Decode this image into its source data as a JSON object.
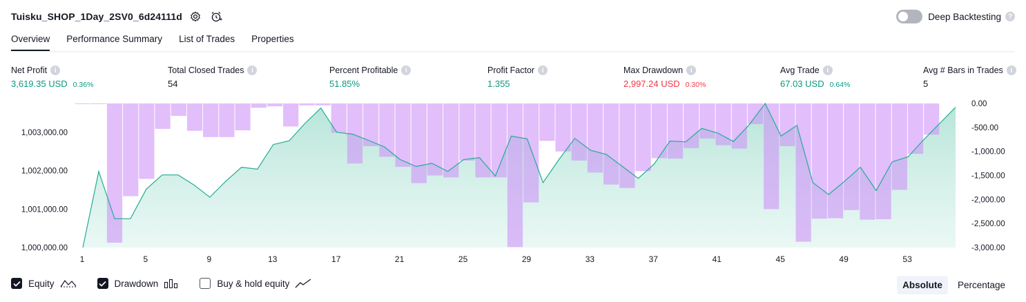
{
  "header": {
    "title": "Tuisku_SHOP_1Day_2SV0_6d24111d",
    "deep_backtesting_label": "Deep Backtesting"
  },
  "tabs": [
    "Overview",
    "Performance Summary",
    "List of Trades",
    "Properties"
  ],
  "stats": [
    {
      "label": "Net Profit",
      "value": "3,619.35 USD",
      "pct": "0.36%",
      "tone": "pos"
    },
    {
      "label": "Total Closed Trades",
      "value": "54",
      "pct": "",
      "tone": "neu"
    },
    {
      "label": "Percent Profitable",
      "value": "51.85%",
      "pct": "",
      "tone": "pos"
    },
    {
      "label": "Profit Factor",
      "value": "1.355",
      "pct": "",
      "tone": "pos"
    },
    {
      "label": "Max Drawdown",
      "value": "2,997.24 USD",
      "pct": "0.30%",
      "tone": "neg"
    },
    {
      "label": "Avg Trade",
      "value": "67.03 USD",
      "pct": "0.64%",
      "tone": "pos"
    },
    {
      "label": "Avg # Bars in Trades",
      "value": "5",
      "pct": "",
      "tone": "neu"
    }
  ],
  "legend": {
    "equity_label": "Equity",
    "drawdown_label": "Drawdown",
    "buyhold_label": "Buy & hold equity",
    "equity_checked": true,
    "drawdown_checked": true,
    "buyhold_checked": false
  },
  "modes": {
    "absolute_label": "Absolute",
    "percentage_label": "Percentage",
    "active": "Absolute"
  },
  "colors": {
    "equity_line": "#22ab94",
    "drawdown_fill": "#ce93f8",
    "positive": "#089981",
    "negative": "#f23645"
  },
  "chart_data": {
    "type": "area",
    "x_ticks": [
      "1",
      "5",
      "9",
      "13",
      "17",
      "21",
      "25",
      "29",
      "33",
      "37",
      "41",
      "45",
      "49",
      "53"
    ],
    "trade_numbers": [
      1,
      2,
      3,
      4,
      5,
      6,
      7,
      8,
      9,
      10,
      11,
      12,
      13,
      14,
      15,
      16,
      17,
      18,
      19,
      20,
      21,
      22,
      23,
      24,
      25,
      26,
      27,
      28,
      29,
      30,
      31,
      32,
      33,
      34,
      35,
      36,
      37,
      38,
      39,
      40,
      41,
      42,
      43,
      44,
      45,
      46,
      47,
      48,
      49,
      50,
      51,
      52,
      53,
      54,
      55
    ],
    "left_axis": {
      "ticks": [
        "1,000,000.00",
        "1,001,000.00",
        "1,002,000.00",
        "1,003,000.00"
      ],
      "range": [
        1000000,
        1003750
      ]
    },
    "right_axis": {
      "ticks": [
        "0.00",
        "-500.00",
        "-1,000.00",
        "-1,500.00",
        "-2,000.00",
        "-2,500.00",
        "-3,000.00"
      ],
      "range": [
        -3000,
        0
      ]
    },
    "series": [
      {
        "name": "Equity",
        "values": [
          1000000,
          1001980,
          1000750,
          1000750,
          1001520,
          1001890,
          1001890,
          1001630,
          1001310,
          1001720,
          1002090,
          1002040,
          1002680,
          1002780,
          1003230,
          1003630,
          1003000,
          1002950,
          1002790,
          1002620,
          1002290,
          1002110,
          1002190,
          1001980,
          1002290,
          1002340,
          1001860,
          1002900,
          1002830,
          1001690,
          1002290,
          1002840,
          1002530,
          1002420,
          1002110,
          1001800,
          1002170,
          1002770,
          1002750,
          1003100,
          1002980,
          1002760,
          1003200,
          1003750,
          1002900,
          1003180,
          1001690,
          1001380,
          1001720,
          1002090,
          1001480,
          1002230,
          1002360,
          1002810,
          1003230,
          1003650
        ]
      },
      {
        "name": "Drawdown",
        "values": [
          -10,
          -10,
          -2900,
          -1930,
          -1570,
          -530,
          -260,
          -570,
          -700,
          -700,
          -560,
          -90,
          -60,
          -480,
          -40,
          -40,
          -610,
          -1250,
          -890,
          -1110,
          -1320,
          -1660,
          -1500,
          -1540,
          -1190,
          -1540,
          -1540,
          -2990,
          -2060,
          -780,
          -1000,
          -1190,
          -1440,
          -1690,
          -1760,
          -1410,
          -1140,
          -1150,
          -930,
          -730,
          -870,
          -940,
          -430,
          -2200,
          -890,
          -2880,
          -2400,
          -2390,
          -2220,
          -2420,
          -2410,
          -1800,
          -1050,
          -650
        ]
      }
    ]
  }
}
